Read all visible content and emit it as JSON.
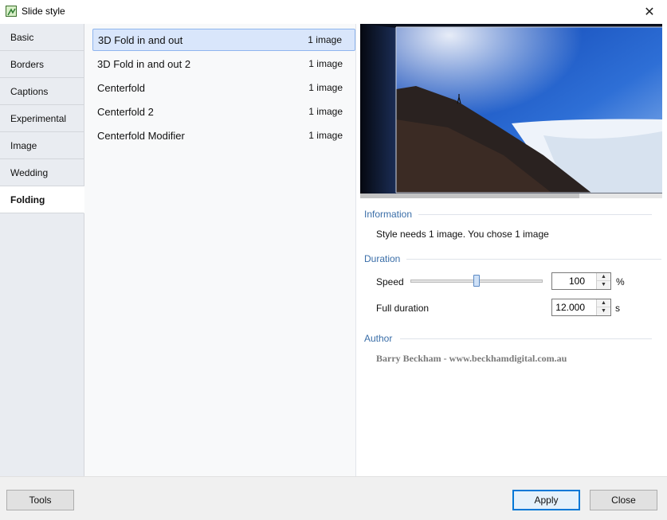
{
  "window": {
    "title": "Slide style",
    "close_glyph": "✕"
  },
  "tabs": [
    {
      "label": "Basic",
      "active": false
    },
    {
      "label": "Borders",
      "active": false
    },
    {
      "label": "Captions",
      "active": false
    },
    {
      "label": "Experimental",
      "active": false
    },
    {
      "label": "Image",
      "active": false
    },
    {
      "label": "Wedding",
      "active": false
    },
    {
      "label": "Folding",
      "active": true
    }
  ],
  "styles": [
    {
      "name": "3D Fold in and out",
      "count": "1 image",
      "selected": true
    },
    {
      "name": "3D Fold in and out 2",
      "count": "1 image",
      "selected": false
    },
    {
      "name": "Centerfold",
      "count": "1 image",
      "selected": false
    },
    {
      "name": "Centerfold 2",
      "count": "1 image",
      "selected": false
    },
    {
      "name": "Centerfold Modifier",
      "count": "1 image",
      "selected": false
    }
  ],
  "information": {
    "heading": "Information",
    "text": "Style needs 1 image. You chose 1 image"
  },
  "duration": {
    "heading": "Duration",
    "speed_label": "Speed",
    "speed_value": "100",
    "speed_unit": "%",
    "speed_slider_fraction": 0.5,
    "full_label": "Full duration",
    "full_value": "12.000",
    "full_unit": "s"
  },
  "author": {
    "heading": "Author",
    "text": "Barry Beckham - www.beckhamdigital.com.au"
  },
  "buttons": {
    "tools": "Tools",
    "apply": "Apply",
    "close": "Close"
  },
  "colors": {
    "accent": "#0078d7",
    "section_heading": "#3a6ea8",
    "selected_row": "#d9e6fb"
  }
}
